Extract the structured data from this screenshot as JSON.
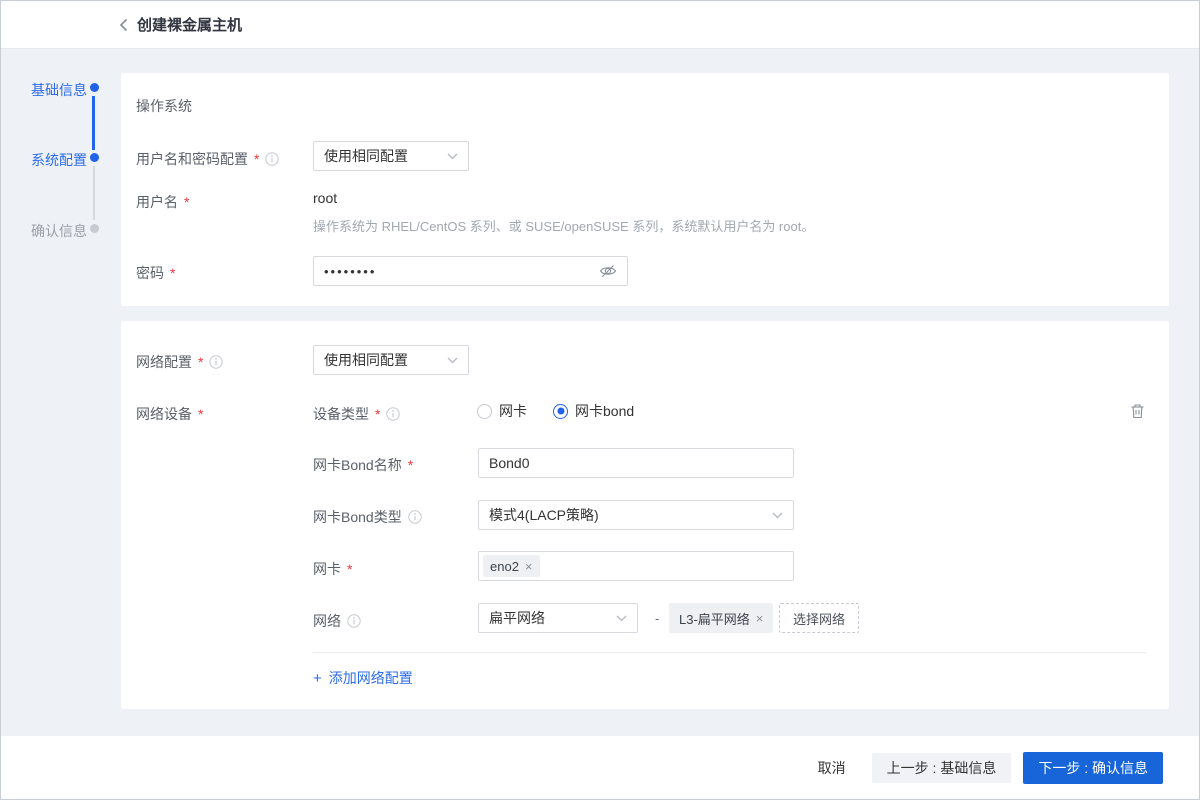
{
  "header": {
    "title": "创建裸金属主机"
  },
  "steps": [
    {
      "label": "基础信息",
      "state": "done"
    },
    {
      "label": "系统配置",
      "state": "active"
    },
    {
      "label": "确认信息",
      "state": "pending"
    }
  ],
  "marks": {
    "required": "*",
    "separator": "-",
    "plus": "+",
    "close": "×"
  },
  "os": {
    "section_title": "操作系统",
    "credential_mode": {
      "label": "用户名和密码配置",
      "value": "使用相同配置"
    },
    "username": {
      "label": "用户名",
      "value": "root",
      "help": "操作系统为 RHEL/CentOS 系列、或 SUSE/openSUSE 系列，系统默认用户名为 root。"
    },
    "password": {
      "label": "密码",
      "masked_value": "••••••••"
    }
  },
  "network": {
    "config_mode": {
      "label": "网络配置",
      "value": "使用相同配置"
    },
    "device": {
      "label": "网络设备"
    },
    "device_type": {
      "label": "设备类型",
      "option_nic": "网卡",
      "option_bond": "网卡bond",
      "selected": "网卡bond"
    },
    "bond_name": {
      "label": "网卡Bond名称",
      "value": "Bond0"
    },
    "bond_type": {
      "label": "网卡Bond类型",
      "value": "模式4(LACP策略)"
    },
    "nic": {
      "label": "网卡",
      "tag": "eno2"
    },
    "net": {
      "label": "网络",
      "type_value": "扁平网络",
      "tag": "L3-扁平网络",
      "choose_button": "选择网络"
    },
    "add_config": "添加网络配置"
  },
  "footer": {
    "cancel": "取消",
    "prev": "上一步 : 基础信息",
    "next": "下一步 : 确认信息"
  },
  "colors": {
    "primary": "#1765d9",
    "link": "#2b6cea",
    "danger": "#f0353f",
    "page_bg": "#eef1f6"
  }
}
